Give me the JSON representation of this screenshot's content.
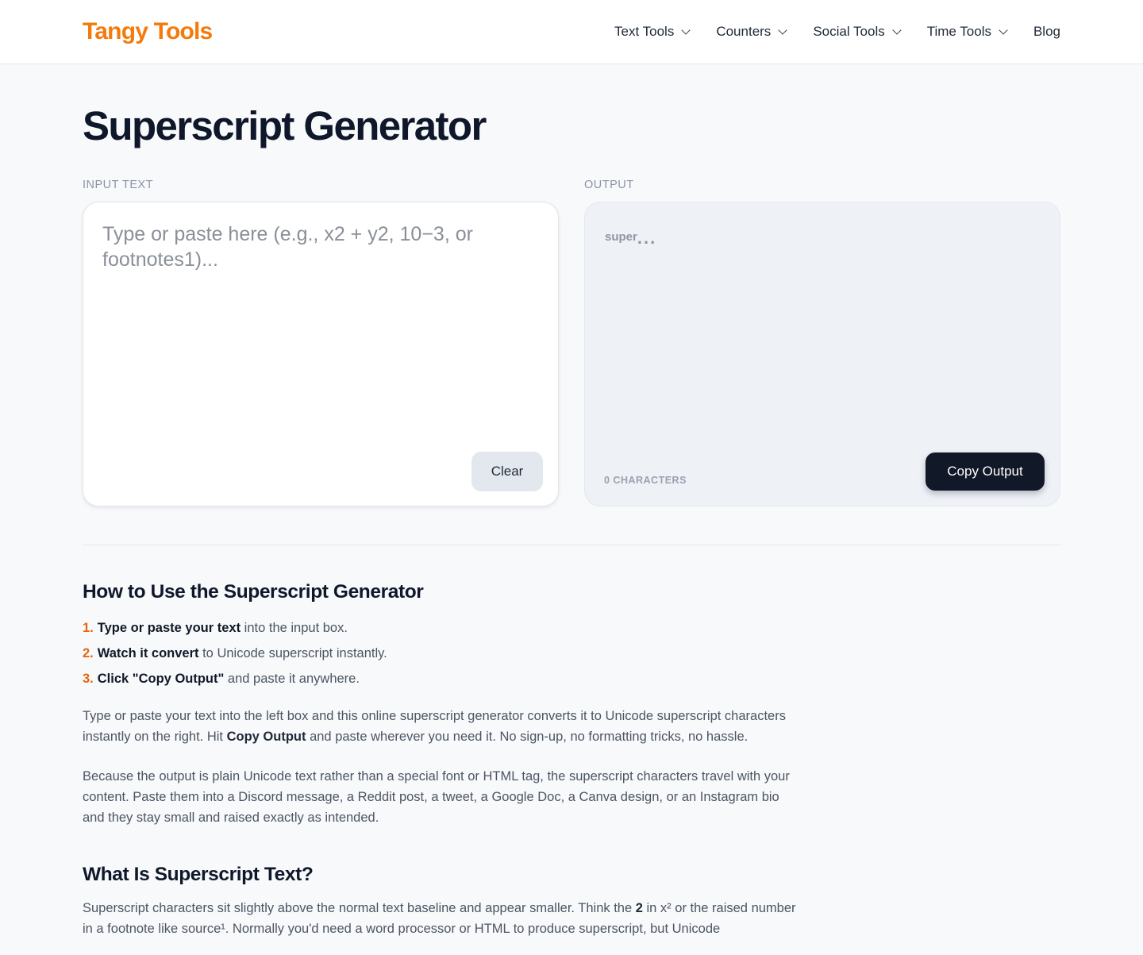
{
  "header": {
    "logo": "Tangy Tools",
    "nav": [
      {
        "label": "Text Tools",
        "has_dropdown": true
      },
      {
        "label": "Counters",
        "has_dropdown": true
      },
      {
        "label": "Social Tools",
        "has_dropdown": true
      },
      {
        "label": "Time Tools",
        "has_dropdown": true
      },
      {
        "label": "Blog",
        "has_dropdown": false
      }
    ]
  },
  "page": {
    "title": "Superscript Generator"
  },
  "input_panel": {
    "label": "INPUT TEXT",
    "value": "",
    "placeholder": "Type or paste here (e.g., x2 + y2, 10−3, or footnotes1)...",
    "clear_label": "Clear"
  },
  "output_panel": {
    "label": "OUTPUT",
    "placeholder_word": "super",
    "placeholder_dots": "...",
    "char_count": "0 CHARACTERS",
    "copy_label": "Copy Output"
  },
  "how_to": {
    "title": "How to Use the Superscript Generator",
    "steps": [
      {
        "num": "1.",
        "bold": "Type or paste your text",
        "rest": " into the input box."
      },
      {
        "num": "2.",
        "bold": "Watch it convert",
        "rest": " to Unicode superscript instantly."
      },
      {
        "num": "3.",
        "bold": "Click \"Copy Output\"",
        "rest": " and paste it anywhere."
      }
    ],
    "para1_a": "Type or paste your text into the left box and this online superscript generator converts it to Unicode superscript characters instantly on the right. Hit ",
    "para1_bold": "Copy Output",
    "para1_b": " and paste wherever you need it. No sign-up, no formatting tricks, no hassle.",
    "para2": "Because the output is plain Unicode text rather than a special font or HTML tag, the superscript characters travel with your content. Paste them into a Discord message, a Reddit post, a tweet, a Google Doc, a Canva design, or an Instagram bio and they stay small and raised exactly as intended."
  },
  "what_is": {
    "title": "What Is Superscript Text?",
    "para_a": "Superscript characters sit slightly above the normal text baseline and appear smaller. Think the ",
    "para_bold": "2",
    "para_b": " in x² or the raised number in a footnote like source¹. Normally you'd need a word processor or HTML to produce superscript, but Unicode"
  },
  "colors": {
    "brand": "#f47a0c",
    "step_number": "#e8650b",
    "copy_button": "#111827"
  }
}
